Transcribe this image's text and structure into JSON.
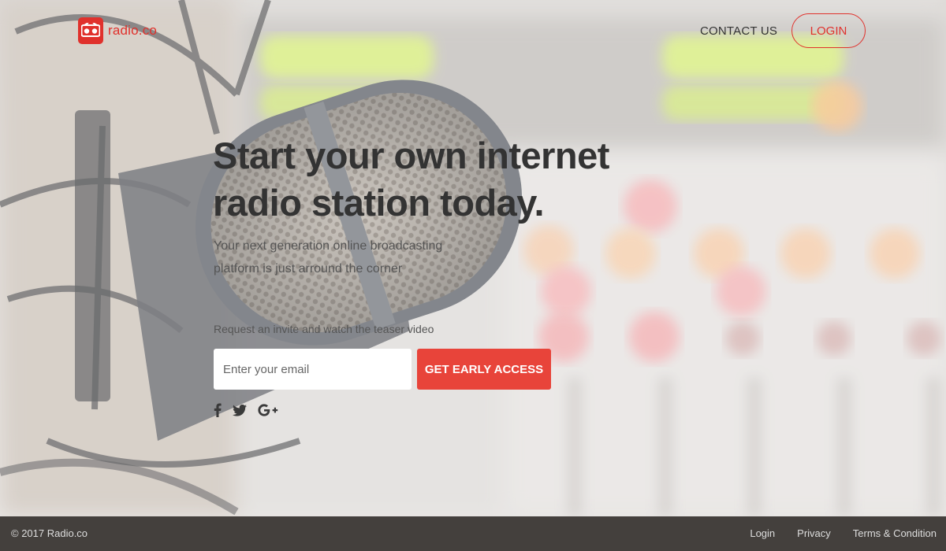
{
  "header": {
    "logo_text": "radio.co",
    "contact_label": "CONTACT US",
    "login_label": "LOGIN"
  },
  "hero": {
    "headline": "Start your own internet radio station today.",
    "subheadline": "Your next generation online broadcasting platform is just arround the corner",
    "invite_text": "Request an invite and watch the teaser video",
    "email_placeholder": "Enter your email",
    "cta_label": "GET EARLY ACCESS",
    "social_icons": [
      "facebook-icon",
      "twitter-icon",
      "google-plus-icon"
    ]
  },
  "footer": {
    "copyright": "© 2017 Radio.co",
    "links": [
      "Login",
      "Privacy",
      "Terms & Condition"
    ]
  },
  "colors": {
    "accent": "#e8443a",
    "logo_red": "#e0312c",
    "headline": "#333333",
    "footer_bg": "#44403d"
  }
}
